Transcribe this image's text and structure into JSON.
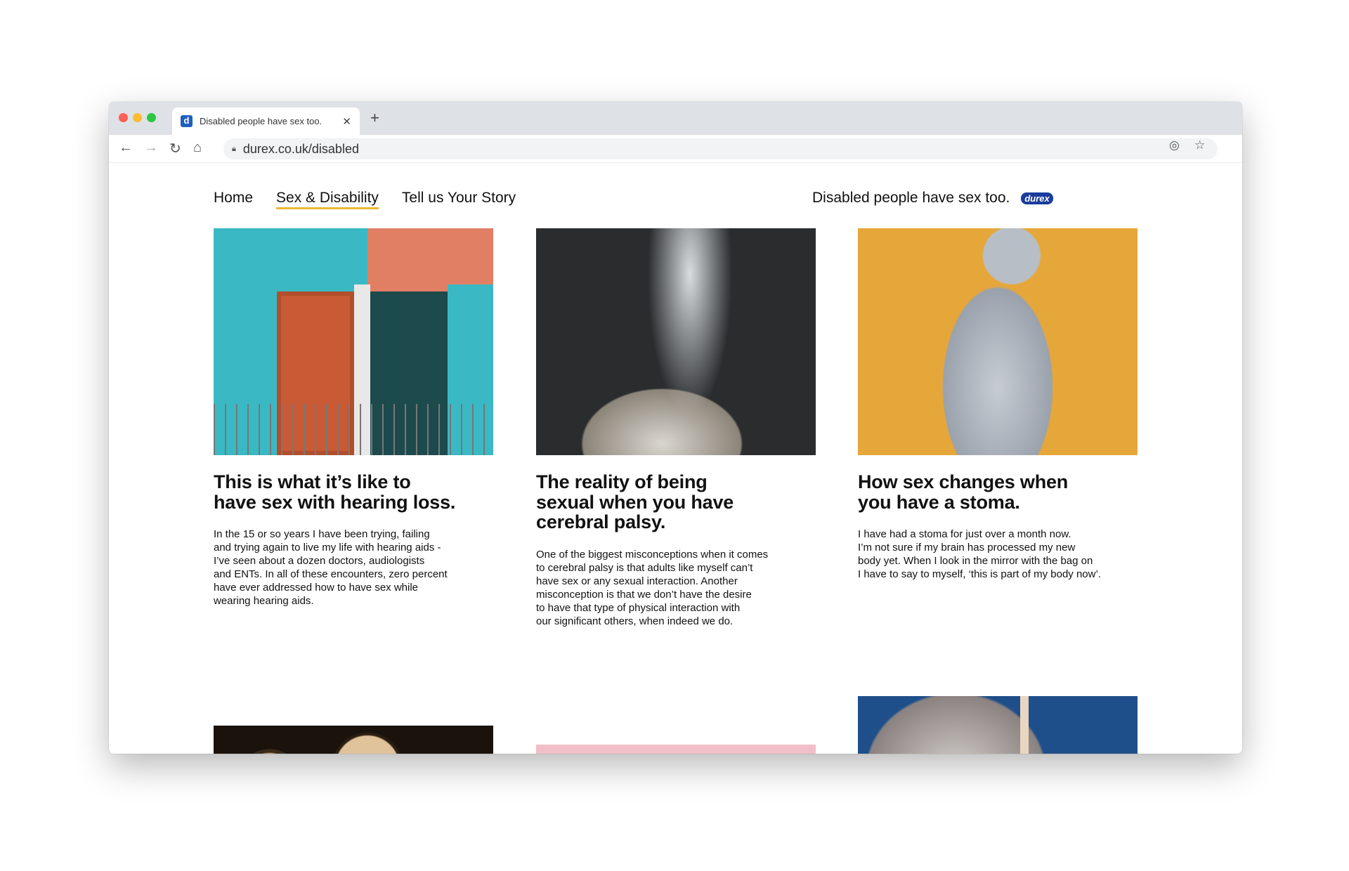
{
  "browser": {
    "tab_title": "Disabled people have sex too.",
    "favicon_letter": "d",
    "url": "durex.co.uk/disabled",
    "icons": [
      "back-arrow-icon",
      "forward-arrow-icon",
      "reload-icon",
      "home-icon",
      "lock-icon",
      "location-icon",
      "star-icon",
      "close-icon",
      "plus-icon"
    ]
  },
  "site": {
    "nav": [
      {
        "label": "Home"
      },
      {
        "label": "Sex & Disability",
        "active": true
      },
      {
        "label": "Tell us Your Story"
      }
    ],
    "tagline": "Disabled people have sex too.",
    "logo": "durex",
    "accent": "#e9b834"
  },
  "articles": [
    {
      "title": [
        "This is what it’s like to",
        "have sex with hearing loss."
      ],
      "body": [
        "In the 15 or so years I have been trying, failing",
        "and trying again to live my life with hearing aids -",
        "I’ve seen about a dozen doctors, audiologists",
        "and ENTs. In all of these encounters, zero percent",
        "have ever addressed how to have sex while",
        "wearing hearing aids."
      ]
    },
    {
      "title": [
        "The reality of being",
        "sexual when you have",
        "cerebral palsy."
      ],
      "body": [
        "One of the biggest misconceptions when it comes",
        "to cerebral palsy is that adults like myself can’t",
        "have sex or any sexual interaction. Another",
        "misconception is that we don’t have the desire",
        "to have that type of physical interaction with",
        "our significant others, when indeed we do."
      ]
    },
    {
      "title": [
        "How sex changes when",
        "you have a stoma."
      ],
      "body": [
        "I have had a stoma for just over a month now.",
        "I’m not sure if my brain has processed my new",
        "body yet. When I look in the mirror with the bag on",
        "I have to say to myself, ‘this is part of my body now’."
      ]
    }
  ]
}
